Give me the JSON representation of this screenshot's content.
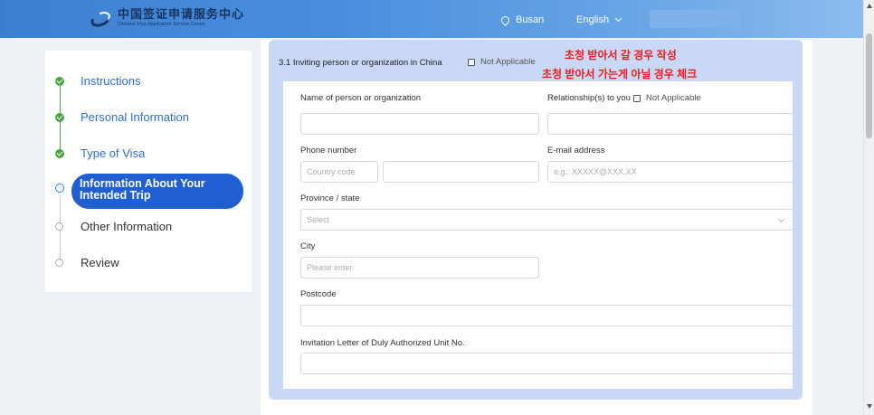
{
  "header": {
    "logo_cn": "中国签证申请服务中心",
    "logo_en": "Chinese Visa Application Service Center",
    "location": "Busan",
    "language": "English",
    "colors": {
      "header_start": "#3c7fd0",
      "header_end": "#8cbdee"
    }
  },
  "sidebar": {
    "steps": [
      {
        "label": "Instructions",
        "status": "done"
      },
      {
        "label": "Personal Information",
        "status": "done"
      },
      {
        "label": "Type of Visa",
        "status": "done"
      },
      {
        "label": "Information About Your Intended Trip",
        "status": "current"
      },
      {
        "label": "Other Information",
        "status": "todo"
      },
      {
        "label": "Review",
        "status": "todo"
      }
    ],
    "colors": {
      "done": "#4ba542",
      "active_pill": "#1f5fd1"
    }
  },
  "section": {
    "title": "3.1 Inviting person or organization in China",
    "not_applicable_label": "Not Applicable",
    "annotation_line1": "초청 받아서 갈 경우 작성",
    "annotation_line2": "초청 받아서 가는게 아닐 경우 체크",
    "annotation_color": "#e8201a"
  },
  "form": {
    "name_label": "Name of person or organization",
    "relationship_label": "Relationship(s) to you",
    "relationship_na_label": "Not Applicable",
    "phone_label": "Phone number",
    "country_code_placeholder": "Country code",
    "email_label": "E-mail address",
    "email_placeholder": "e.g.: XXXXX@XXX.XX",
    "province_label": "Province / state",
    "province_placeholder": "Select",
    "city_label": "City",
    "city_placeholder": "Please enter",
    "postcode_label": "Postcode",
    "invitation_label": "Invitation Letter of Duly Authorized Unit No."
  }
}
